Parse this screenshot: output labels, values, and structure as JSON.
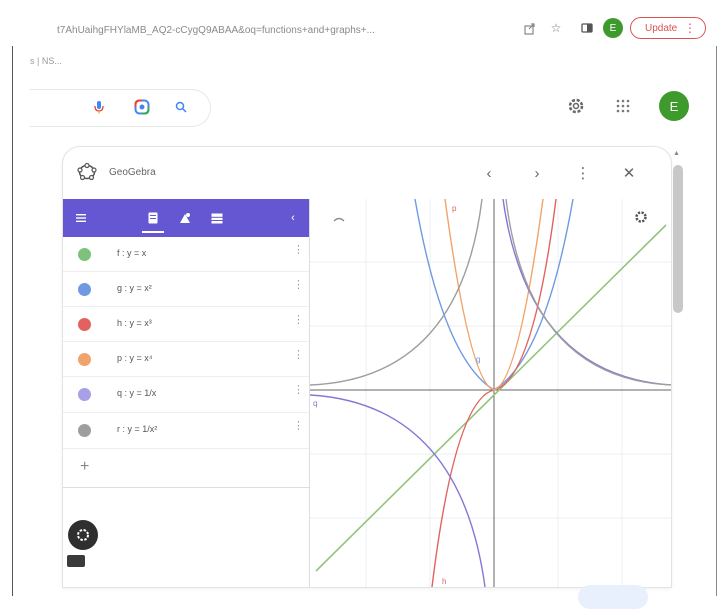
{
  "browser": {
    "url": "t7AhUaihgFHYlaMB_AQ2-cCygQ9ABAA&oq=functions+and+graphs+...",
    "update_label": "Update",
    "update_menu": "⋮",
    "avatar_letter": "E",
    "tab_hint": "s | NS..."
  },
  "search": {
    "avatar_letter": "E"
  },
  "geogebra": {
    "title": "GeoGebra",
    "prev": "‹",
    "next": "›",
    "menu": "⋮",
    "close": "✕",
    "add_symbol": "+",
    "objects": [
      {
        "color": "#7cc27a",
        "label": "f : y = x",
        "more": "⋮"
      },
      {
        "color": "#6f9ae2",
        "label": "g : y = x²",
        "more": "⋮"
      },
      {
        "color": "#e2625e",
        "label": "h : y = x³",
        "more": "⋮"
      },
      {
        "color": "#f2a36b",
        "label": "p : y = x⁴",
        "more": "⋮"
      },
      {
        "color": "#a8a0e6",
        "label": "q : y = 1/x",
        "more": "⋮"
      },
      {
        "color": "#9e9e9e",
        "label": "r : y = 1/x²",
        "more": "⋮"
      }
    ],
    "graph_labels": [
      {
        "text": "p",
        "color": "#e2625e"
      },
      {
        "text": "g",
        "color": "#6f9ae2"
      },
      {
        "text": "q",
        "color": "#8478d6"
      },
      {
        "text": "h",
        "color": "#e2625e"
      }
    ]
  },
  "colors": {
    "toolbar_purple": "#6557d2",
    "update_red": "#d9534f",
    "avatar_green": "#3f9a2e"
  }
}
